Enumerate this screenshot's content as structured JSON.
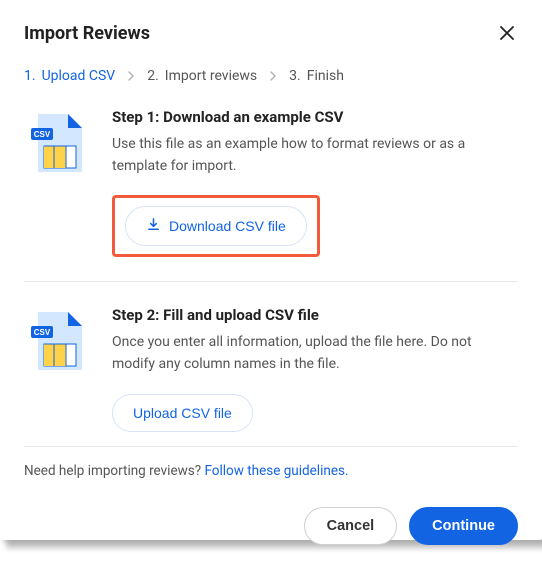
{
  "header": {
    "title": "Import Reviews"
  },
  "stepper": {
    "items": [
      {
        "num": "1.",
        "label": "Upload CSV"
      },
      {
        "num": "2.",
        "label": "Import reviews"
      },
      {
        "num": "3.",
        "label": "Finish"
      }
    ]
  },
  "sections": [
    {
      "title": "Step 1: Download an example CSV",
      "desc": "Use this file as an example how to format reviews or as a template for import.",
      "button": "Download CSV file",
      "has_download_icon": true,
      "highlighted": true
    },
    {
      "title": "Step 2: Fill and upload CSV file",
      "desc": "Once you enter all information, upload the file here. Do not modify any column names in the file.",
      "button": "Upload CSV file",
      "has_download_icon": false,
      "highlighted": false
    }
  ],
  "help": {
    "prefix": "Need help importing reviews? ",
    "link": "Follow these guidelines."
  },
  "footer": {
    "cancel": "Cancel",
    "continue": "Continue"
  }
}
